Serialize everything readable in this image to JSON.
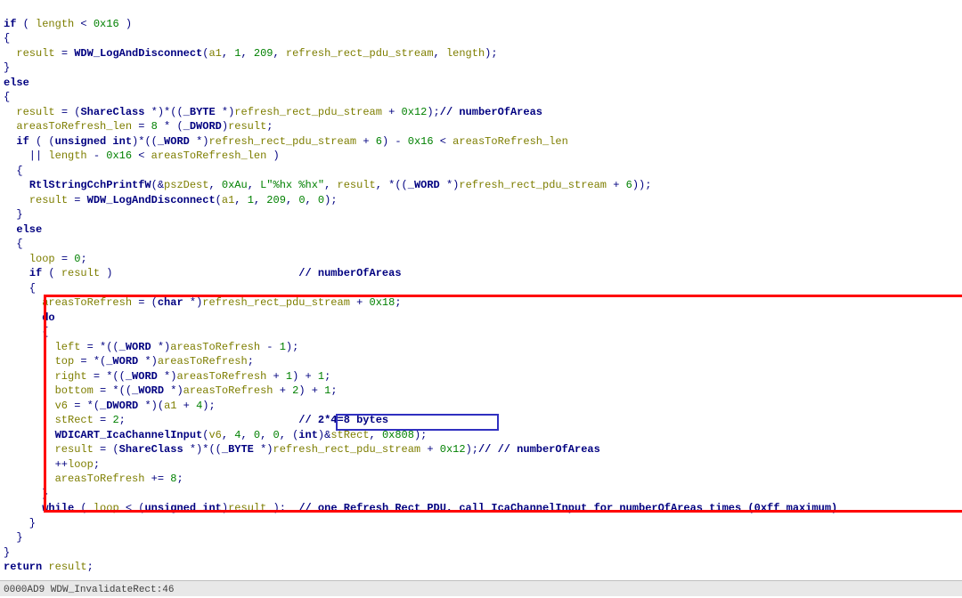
{
  "L1": "if ( length < 0x16 )",
  "L2": "{",
  "L3": "  result = WDW_LogAndDisconnect(a1, 1, 209, refresh_rect_pdu_stream, length);",
  "L4": "}",
  "L5": "else",
  "L6": "{",
  "L7": "  result = (ShareClass *)*((_BYTE *)refresh_rect_pdu_stream + 0x12);// numberOfAreas",
  "L8": "  areasToRefresh_len = 8 * (_DWORD)result;",
  "L9": "  if ( (unsigned int)*((_WORD *)refresh_rect_pdu_stream + 6) - 0x16 < areasToRefresh_len",
  "L10": "    || length - 0x16 < areasToRefresh_len )",
  "L11": "  {",
  "L12": "    RtlStringCchPrintfW(&pszDest, 0xAu, L\"%hx %hx\", result, *((_WORD *)refresh_rect_pdu_stream + 6));",
  "L13": "    result = WDW_LogAndDisconnect(a1, 1, 209, 0, 0);",
  "L14": "  }",
  "L15": "  else",
  "L16": "  {",
  "L17": "    loop = 0;",
  "L18": "    if ( result )                             // numberOfAreas",
  "L19": "    {",
  "L20": "      areasToRefresh = (char *)refresh_rect_pdu_stream + 0x18;",
  "L21": "      do",
  "L22": "      {",
  "L23": "        left = *((_WORD *)areasToRefresh - 1);",
  "L24": "        top = *(_WORD *)areasToRefresh;",
  "L25": "        right = *((_WORD *)areasToRefresh + 1) + 1;",
  "L26": "        bottom = *((_WORD *)areasToRefresh + 2) + 1;",
  "L27": "        v6 = *(_DWORD *)(a1 + 4);",
  "L28": "        stRect = 2;                           // 2*4=8 bytes",
  "L29": "        WDICART_IcaChannelInput(v6, 4, 0, 0, (int)&stRect, 0x808);",
  "L30": "        result = (ShareClass *)*((_BYTE *)refresh_rect_pdu_stream + 0x12);// // numberOfAreas",
  "L31": "        ++loop;",
  "L32": "        areasToRefresh += 8;",
  "L33": "      }",
  "L34": "      while ( loop < (unsigned int)result );  // one Refresh Rect PDU, call IcaChannelInput for numberOfAreas times (0xff maximum)",
  "L35": "    }",
  "L36": "  }",
  "L37": "}",
  "L38": "return result;",
  "status": "0000AD9 WDW_InvalidateRect:46"
}
